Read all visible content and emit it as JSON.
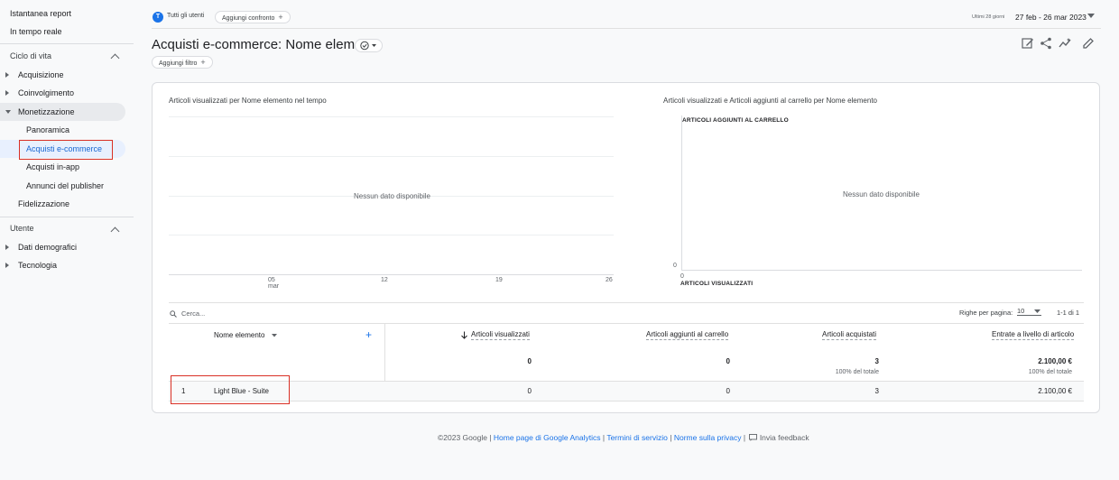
{
  "sidebar": {
    "top_items": [
      "Istantanea report",
      "In tempo reale"
    ],
    "lifecycle_section": "Ciclo di vita",
    "lifecycle_items": [
      "Acquisizione",
      "Coinvolgimento",
      "Monetizzazione"
    ],
    "monetization_items": [
      "Panoramica",
      "Acquisti e-commerce",
      "Acquisti in-app",
      "Annunci del publisher"
    ],
    "retention_item": "Fidelizzazione",
    "user_section": "Utente",
    "user_items": [
      "Dati demografici",
      "Tecnologia"
    ]
  },
  "header": {
    "avatar_letter": "T",
    "all_users": "Tutti gli utenti",
    "add_comparison": "Aggiungi confronto",
    "date_prefix": "Ultimi 28 giorni",
    "date_range": "27 feb - 26 mar 2023",
    "title": "Acquisti e-commerce: Nome elemento",
    "add_filter": "Aggiungi filtro"
  },
  "charts": {
    "left_title": "Articoli visualizzati per Nome elemento nel tempo",
    "left_no_data": "Nessun dato disponibile",
    "left_x_ticks": [
      "05",
      "12",
      "19",
      "26"
    ],
    "left_x_month": "mar",
    "right_title": "Articoli visualizzati e Articoli aggiunti al carrello per Nome elemento",
    "right_y_label": "ARTICOLI AGGIUNTI AL CARRELLO",
    "right_no_data": "Nessun dato disponibile",
    "right_y_zero": "0",
    "right_x_zero": "0",
    "right_x_label": "ARTICOLI VISUALIZZATI"
  },
  "table": {
    "search_placeholder": "Cerca...",
    "rows_per_page_label": "Righe per pagina:",
    "rows_per_page_value": "10",
    "pagination": "1-1 di 1",
    "dimension_header": "Nome elemento",
    "col_headers": [
      "Articoli visualizzati",
      "Articoli aggiunti al carrello",
      "Articoli acquistati",
      "Entrate a livello di articolo"
    ],
    "totals": [
      "0",
      "0",
      "3",
      "2.100,00 €"
    ],
    "totals_sub": [
      "100% del totale",
      "100% del totale"
    ],
    "rows": [
      {
        "index": "1",
        "name": "Light Blue - Suite",
        "values": [
          "0",
          "0",
          "3",
          "2.100,00 €"
        ]
      }
    ]
  },
  "footer": {
    "copyright": "©2023 Google |",
    "link_home": "Home page di Google Analytics",
    "sep1": "|",
    "link_terms": "Termini di servizio",
    "sep2": "|",
    "link_privacy": "Norme sulla privacy",
    "sep3": "|",
    "feedback": "Invia feedback"
  },
  "colors": {
    "accent": "#1a73e8",
    "highlight": "#d93025"
  }
}
